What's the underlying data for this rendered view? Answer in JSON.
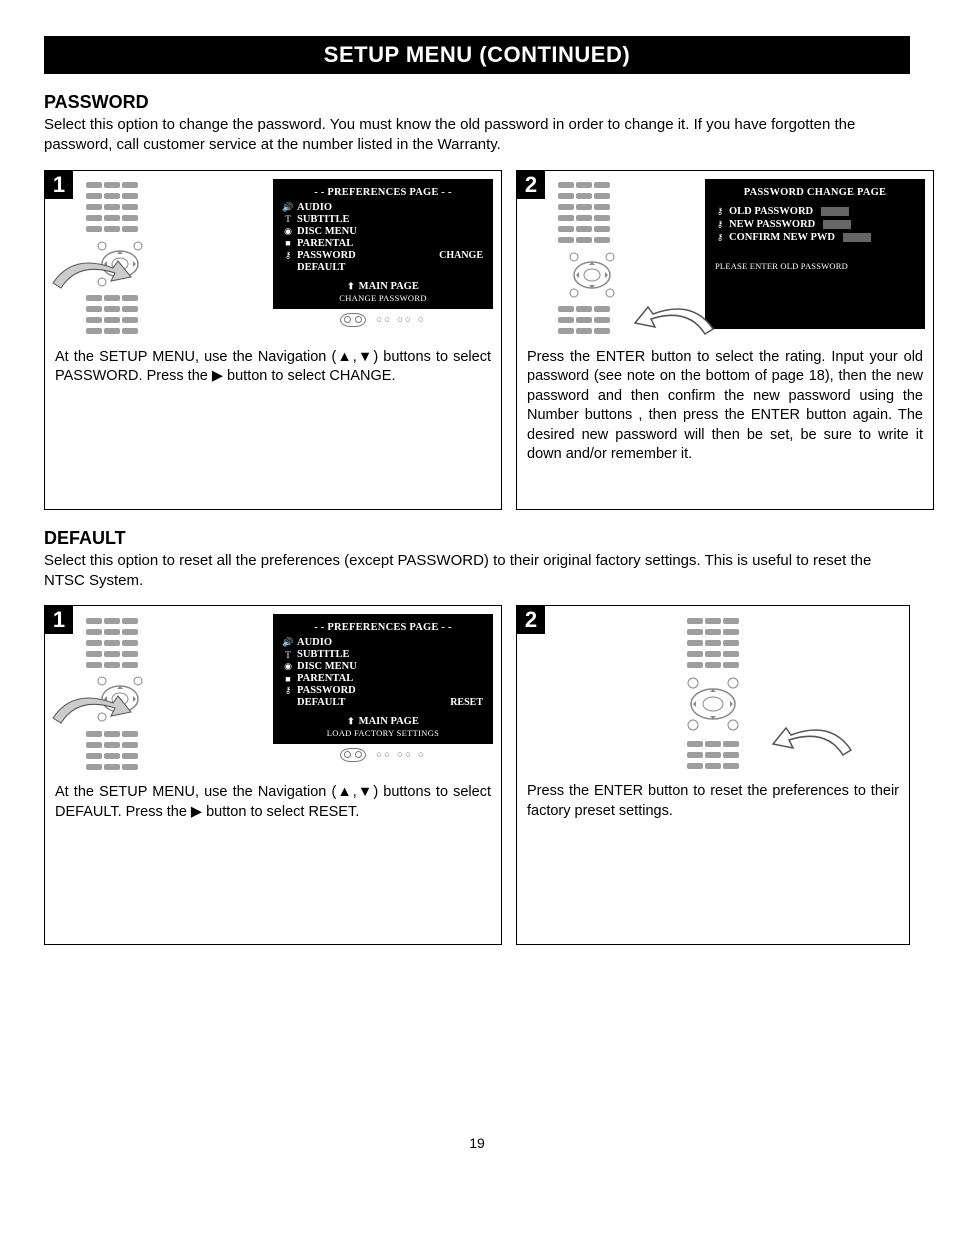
{
  "header": {
    "title": "SETUP MENU (CONTINUED)"
  },
  "password": {
    "heading": "PASSWORD",
    "body": "Select this option to change the password. You must know the old password in order to change it. If you have forgotten the password, call customer service at the number listed in the Warranty.",
    "step1": {
      "num": "1",
      "screen": {
        "title": "- - PREFERENCES PAGE - -",
        "items": [
          {
            "icon": "speaker",
            "label": "AUDIO"
          },
          {
            "icon": "T",
            "label": "SUBTITLE"
          },
          {
            "icon": "disc",
            "label": "DISC MENU"
          },
          {
            "icon": "square",
            "label": "PARENTAL"
          },
          {
            "icon": "key",
            "label": "PASSWORD",
            "value": "CHANGE"
          },
          {
            "icon": "",
            "label": "DEFAULT"
          }
        ],
        "main": "MAIN PAGE",
        "hint": "CHANGE PASSWORD"
      },
      "caption": "At the SETUP MENU, use the Navigation (▲,▼) buttons to select PASSWORD. Press the ▶ button  to select CHANGE."
    },
    "step2": {
      "num": "2",
      "screen": {
        "title": "PASSWORD CHANGE PAGE",
        "rows": [
          {
            "label": "OLD PASSWORD"
          },
          {
            "label": "NEW PASSWORD"
          },
          {
            "label": "CONFIRM NEW PWD"
          }
        ],
        "hint": "PLEASE ENTER OLD PASSWORD"
      },
      "caption": "Press the ENTER button  to select the rating. Input your old password (see note on the bottom of page 18), then the new password and then confirm the new password using the Number buttons , then press the ENTER button  again. The desired new password will then be set, be sure to write it down and/or remember it."
    }
  },
  "default": {
    "heading": "DEFAULT",
    "body": "Select this option to reset all the preferences (except PASSWORD) to their original factory settings. This is useful to reset the NTSC System.",
    "step1": {
      "num": "1",
      "screen": {
        "title": "- - PREFERENCES PAGE - -",
        "items": [
          {
            "icon": "speaker",
            "label": "AUDIO"
          },
          {
            "icon": "T",
            "label": "SUBTITLE"
          },
          {
            "icon": "disc",
            "label": "DISC MENU"
          },
          {
            "icon": "square",
            "label": "PARENTAL"
          },
          {
            "icon": "key",
            "label": "PASSWORD"
          },
          {
            "icon": "",
            "label": "DEFAULT",
            "value": "RESET"
          }
        ],
        "main": "MAIN PAGE",
        "hint": "LOAD FACTORY SETTINGS"
      },
      "caption": "At the SETUP MENU, use the Navigation (▲,▼) buttons to select DEFAULT. Press the ▶ button  to select RESET."
    },
    "step2": {
      "num": "2",
      "caption": "Press the ENTER button to reset the preferences to their factory preset settings."
    }
  },
  "pagenum": "19"
}
